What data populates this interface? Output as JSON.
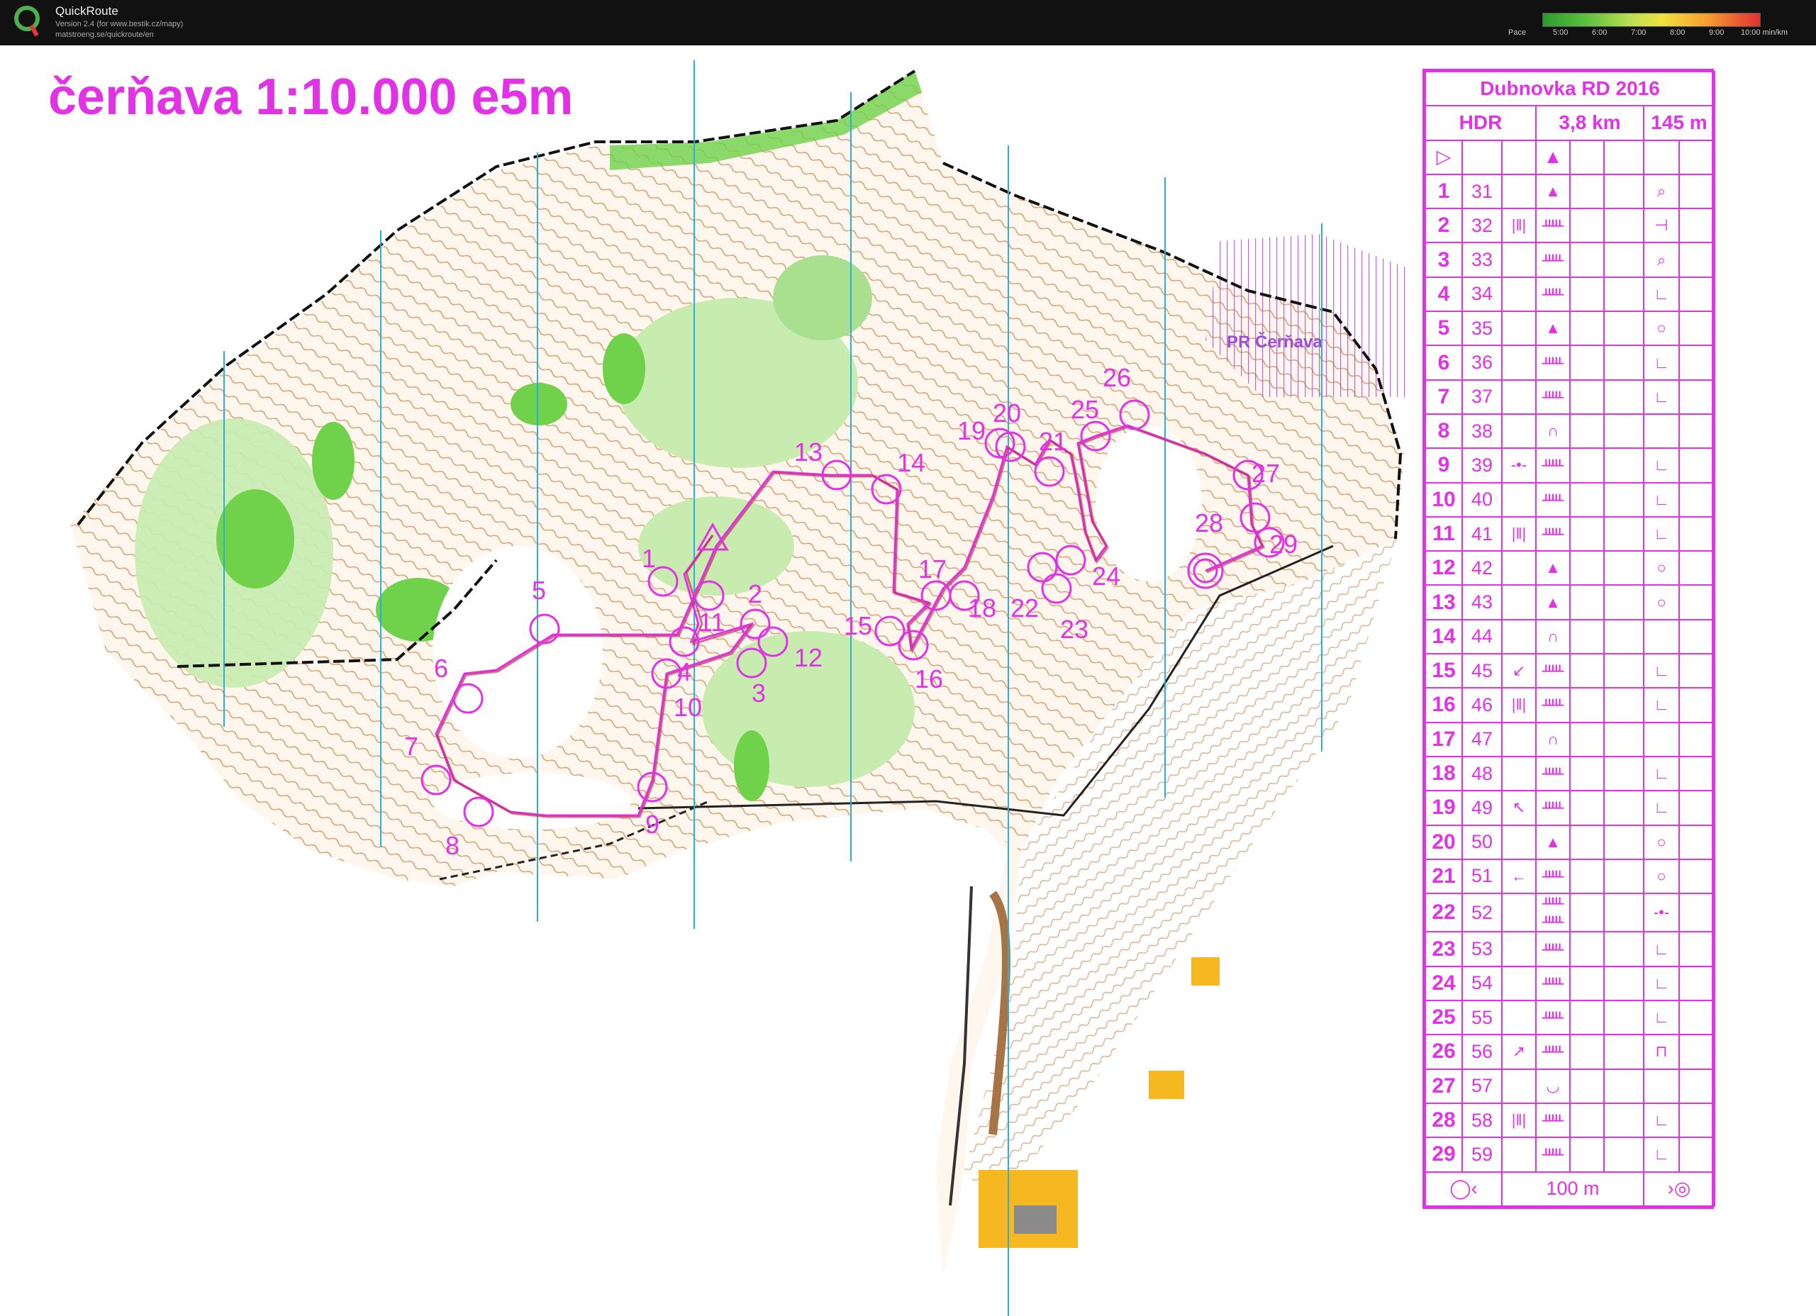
{
  "app": {
    "name": "QuickRoute",
    "version": "Version 2.4  (for www.bestik.cz/mapy)",
    "url": "matstroeng.se/quickroute/en"
  },
  "pace_legend": {
    "label": "Pace",
    "ticks": [
      "5:00",
      "6:00",
      "7:00",
      "8:00",
      "9:00",
      "10:00 min/km"
    ]
  },
  "map": {
    "title": "čerňava 1:10.000 e5m",
    "area_label": "PR Čerňava",
    "control_labels": [
      "1",
      "2",
      "3",
      "4",
      "5",
      "6",
      "7",
      "8",
      "9",
      "10",
      "11",
      "12",
      "13",
      "14",
      "15",
      "16",
      "17",
      "18",
      "19",
      "20",
      "21",
      "22",
      "23",
      "24",
      "25",
      "26",
      "27",
      "28",
      "29"
    ]
  },
  "description": {
    "event": "Dubnovka RD 2016",
    "class": "HDR",
    "length": "3,8 km",
    "climb": "145 m",
    "finish_note": "100 m",
    "controls": [
      {
        "n": "1",
        "code": "31",
        "c": "",
        "d": "▲",
        "g": "⌕"
      },
      {
        "n": "2",
        "code": "32",
        "c": "|‖|",
        "d": "ᚊ",
        "g": "⊣"
      },
      {
        "n": "3",
        "code": "33",
        "c": "",
        "d": "ᚊ",
        "g": "⌕"
      },
      {
        "n": "4",
        "code": "34",
        "c": "",
        "d": "ᚊ",
        "g": "∟"
      },
      {
        "n": "5",
        "code": "35",
        "c": "",
        "d": "▲",
        "g": "○"
      },
      {
        "n": "6",
        "code": "36",
        "c": "",
        "d": "ᚊ",
        "g": "∟"
      },
      {
        "n": "7",
        "code": "37",
        "c": "",
        "d": "ᚊ",
        "g": "∟"
      },
      {
        "n": "8",
        "code": "38",
        "c": "",
        "d": "∩",
        "g": ""
      },
      {
        "n": "9",
        "code": "39",
        "c": "-•-",
        "d": "ᚊ",
        "g": "∟"
      },
      {
        "n": "10",
        "code": "40",
        "c": "",
        "d": "ᚊ",
        "g": "∟"
      },
      {
        "n": "11",
        "code": "41",
        "c": "|‖|",
        "d": "ᚊ",
        "g": "∟"
      },
      {
        "n": "12",
        "code": "42",
        "c": "",
        "d": "▲",
        "g": "○"
      },
      {
        "n": "13",
        "code": "43",
        "c": "",
        "d": "▲",
        "g": "○"
      },
      {
        "n": "14",
        "code": "44",
        "c": "",
        "d": "∩",
        "g": ""
      },
      {
        "n": "15",
        "code": "45",
        "c": "↙",
        "d": "ᚊ",
        "g": "∟"
      },
      {
        "n": "16",
        "code": "46",
        "c": "|‖|",
        "d": "ᚊ",
        "g": "∟"
      },
      {
        "n": "17",
        "code": "47",
        "c": "",
        "d": "∩",
        "g": ""
      },
      {
        "n": "18",
        "code": "48",
        "c": "",
        "d": "ᚊ",
        "g": "∟"
      },
      {
        "n": "19",
        "code": "49",
        "c": "↖",
        "d": "ᚊ",
        "g": "∟"
      },
      {
        "n": "20",
        "code": "50",
        "c": "",
        "d": "▲",
        "g": "○"
      },
      {
        "n": "21",
        "code": "51",
        "c": "←",
        "d": "ᚊ",
        "g": "○"
      },
      {
        "n": "22",
        "code": "52",
        "c": "",
        "d": "ᚊ ᚊ",
        "g": "-•-"
      },
      {
        "n": "23",
        "code": "53",
        "c": "",
        "d": "ᚊ",
        "g": "∟"
      },
      {
        "n": "24",
        "code": "54",
        "c": "",
        "d": "ᚊ",
        "g": "∟"
      },
      {
        "n": "25",
        "code": "55",
        "c": "",
        "d": "ᚊ",
        "g": "∟"
      },
      {
        "n": "26",
        "code": "56",
        "c": "↗",
        "d": "ᚊ",
        "g": "⊓"
      },
      {
        "n": "27",
        "code": "57",
        "c": "",
        "d": "◡",
        "g": ""
      },
      {
        "n": "28",
        "code": "58",
        "c": "|‖|",
        "d": "ᚊ",
        "g": "∟"
      },
      {
        "n": "29",
        "code": "59",
        "c": "",
        "d": "ᚊ",
        "g": "∟"
      }
    ]
  },
  "colors": {
    "magenta": "#e232e6",
    "contour": "#b5651d",
    "forest_light": "#c8ecb0",
    "forest_dark": "#6fd24a",
    "meridian": "#2ab0d8"
  }
}
